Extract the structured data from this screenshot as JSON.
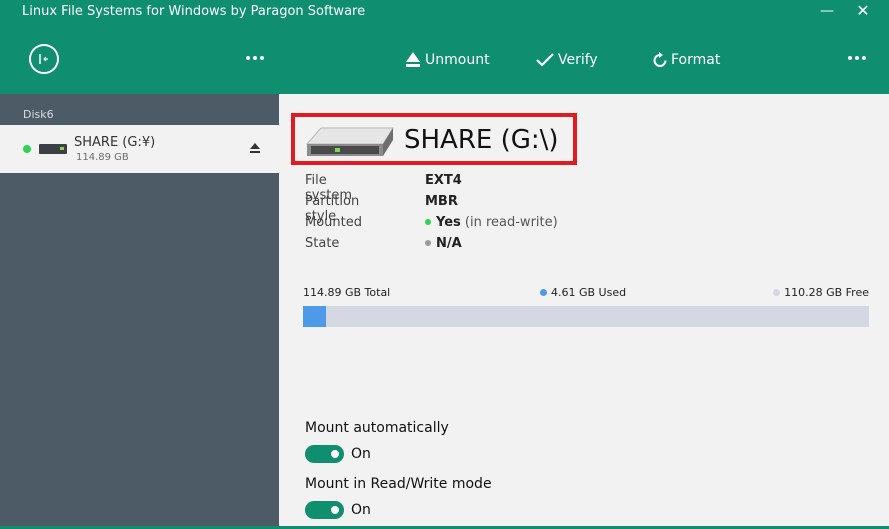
{
  "window": {
    "title": "Linux File Systems for Windows by Paragon Software",
    "minimize_glyph": "—",
    "close_glyph": "✕"
  },
  "toolbar": {
    "back_icon": "back-arrow-icon",
    "more_icon": "more-dots-icon",
    "unmount_label": "Unmount",
    "verify_label": "Verify",
    "format_label": "Format",
    "accent_color": "#0f8e70"
  },
  "sidebar": {
    "group_label": "Disk6",
    "items": [
      {
        "name": "SHARE (G:¥)",
        "size": "114.89 GB",
        "status_color": "#2ad553"
      }
    ]
  },
  "volume": {
    "title": "SHARE (G:\\)",
    "properties": [
      {
        "label": "File system",
        "value": "EXT4",
        "sub": ""
      },
      {
        "label": "Partition style",
        "value": "MBR",
        "sub": ""
      },
      {
        "label": "Mounted",
        "value": "Yes",
        "sub": " (in read-write)",
        "dot_color": "#2ad553"
      },
      {
        "label": "State",
        "value": "N/A",
        "sub": "",
        "dot_color": "#9a9a9a"
      }
    ]
  },
  "usage": {
    "total_label": "114.89 GB Total",
    "used_label": "4.61 GB Used",
    "free_label": "110.28 GB Free",
    "used_fraction": 0.0401,
    "used_color": "#4e9ae8",
    "free_color": "#d4d8e2"
  },
  "options": {
    "mount_auto_label": "Mount automatically",
    "mount_auto_state": "On",
    "mount_rw_label": "Mount in Read/Write mode",
    "mount_rw_state": "On"
  }
}
